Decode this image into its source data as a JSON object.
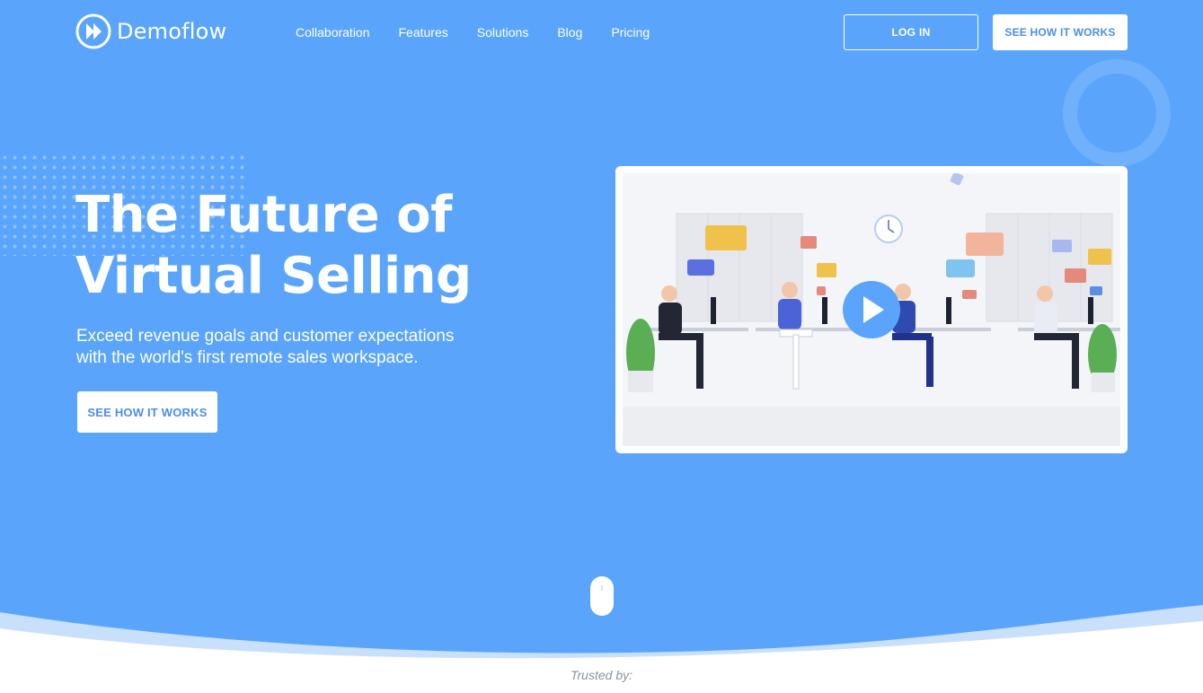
{
  "brand": {
    "name": "Demoflow",
    "icon": "fast-forward-play-icon",
    "color": "#ffffff"
  },
  "nav": {
    "items": [
      "Collaboration",
      "Features",
      "Solutions",
      "Blog",
      "Pricing"
    ]
  },
  "header": {
    "login_label": "LOG IN",
    "cta_label": "SEE HOW IT WORKS"
  },
  "hero": {
    "title_line1": "The Future of",
    "title_line2": "Virtual Selling",
    "subtitle_line1": "Exceed revenue goals and customer expectations",
    "subtitle_line2": "with the world's first remote sales workspace.",
    "cta_label": "SEE HOW IT WORKS",
    "video": {
      "play_icon": "play-icon"
    }
  },
  "scroll_indicator": {
    "icon": "mouse-scroll-icon"
  },
  "trusted": {
    "label": "Trusted by:"
  },
  "colors": {
    "hero_bg": "#5aa5fb",
    "accent": "#4a8fe6",
    "white": "#ffffff"
  }
}
